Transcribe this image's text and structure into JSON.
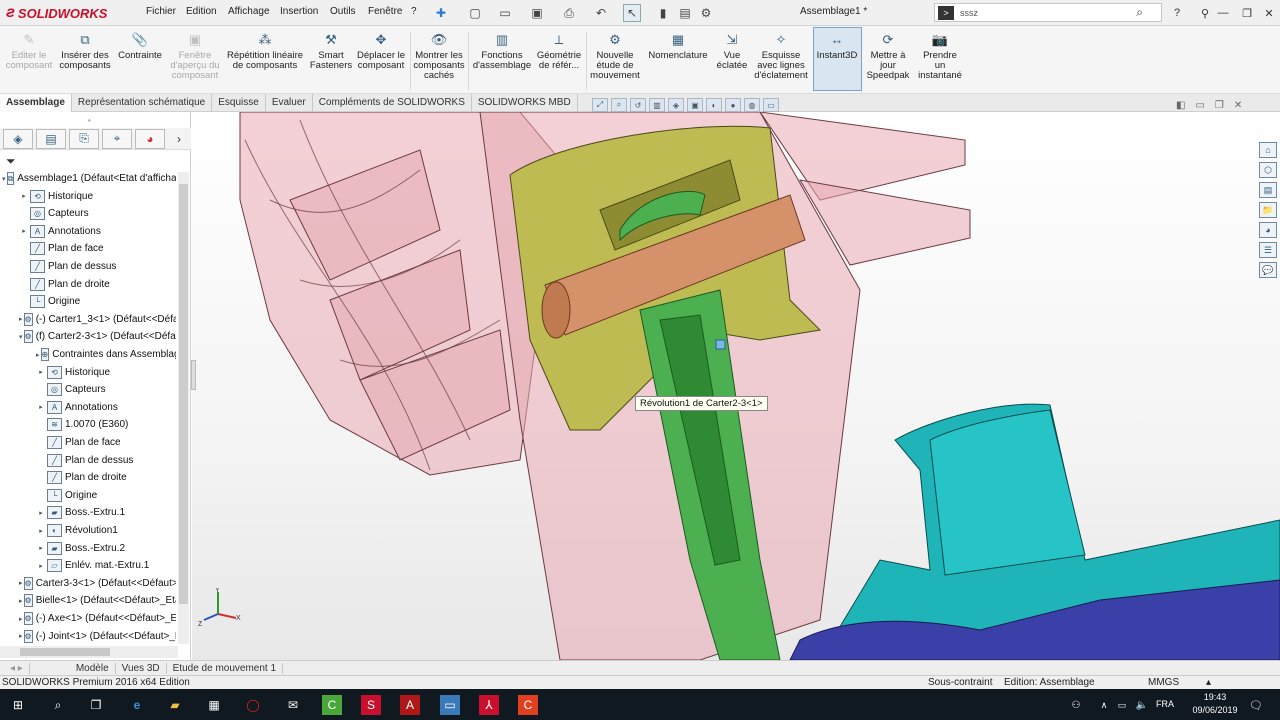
{
  "app": {
    "brand": "SOLIDWORKS",
    "doc_title": "Assemblage1 *"
  },
  "menus": [
    "Fichier",
    "Edition",
    "Affichage",
    "Insertion",
    "Outils",
    "Fenêtre",
    "?"
  ],
  "search": {
    "value": "sssz"
  },
  "ribbon": [
    {
      "label": "Editer le\ncomposant",
      "icon": "edit-component-icon",
      "disabled": true
    },
    {
      "label": "Insérer des\ncomposants",
      "icon": "insert-components-icon",
      "disabled": false
    },
    {
      "label": "Contrainte",
      "icon": "mate-icon",
      "disabled": false
    },
    {
      "label": "Fenêtre\nd'aperçu du\ncomposant",
      "icon": "component-preview-icon",
      "disabled": true
    },
    {
      "label": "Répétition linéaire\nde composants",
      "icon": "linear-pattern-icon",
      "disabled": false
    },
    {
      "label": "Smart\nFasteners",
      "icon": "smart-fasteners-icon",
      "disabled": false
    },
    {
      "label": "Déplacer le\ncomposant",
      "icon": "move-component-icon",
      "disabled": false
    },
    {
      "label": "Montrer les\ncomposants\ncachés",
      "icon": "show-hidden-icon",
      "disabled": false
    },
    {
      "label": "Fonctions\nd'assemblage",
      "icon": "assembly-features-icon",
      "disabled": false
    },
    {
      "label": "Géométrie\nde référ...",
      "icon": "reference-geometry-icon",
      "disabled": false
    },
    {
      "label": "Nouvelle\nétude de\nmouvement",
      "icon": "motion-study-icon",
      "disabled": false
    },
    {
      "label": "Nomenclature",
      "icon": "bom-icon",
      "disabled": false
    },
    {
      "label": "Vue\néclatée",
      "icon": "exploded-view-icon",
      "disabled": false
    },
    {
      "label": "Esquisse\navec lignes\nd'éclatement",
      "icon": "explode-line-sketch-icon",
      "disabled": false
    },
    {
      "label": "Instant3D",
      "icon": "instant3d-icon",
      "disabled": false,
      "active": true
    },
    {
      "label": "Mettre à\njour\nSpeedpak",
      "icon": "speedpak-icon",
      "disabled": false
    },
    {
      "label": "Prendre\nun\ninstantané",
      "icon": "snapshot-icon",
      "disabled": false
    }
  ],
  "tabs": [
    "Assemblage",
    "Représentation schématique",
    "Esquisse",
    "Evaluer",
    "Compléments de SOLIDWORKS",
    "SOLIDWORKS MBD"
  ],
  "active_tab": "Assemblage",
  "tree": [
    {
      "level": 0,
      "exp": "▾",
      "label": "Assemblage1  (Défaut<Etat d'affichag",
      "icon": "assembly-icon"
    },
    {
      "level": 1,
      "exp": "▸",
      "label": "Historique",
      "icon": "history-icon"
    },
    {
      "level": 1,
      "exp": "",
      "label": "Capteurs",
      "icon": "sensor-icon"
    },
    {
      "level": 1,
      "exp": "▸",
      "label": "Annotations",
      "icon": "annotation-icon"
    },
    {
      "level": 1,
      "exp": "",
      "label": "Plan de face",
      "icon": "plane-icon"
    },
    {
      "level": 1,
      "exp": "",
      "label": "Plan de dessus",
      "icon": "plane-icon"
    },
    {
      "level": 1,
      "exp": "",
      "label": "Plan de droite",
      "icon": "plane-icon"
    },
    {
      "level": 1,
      "exp": "",
      "label": "Origine",
      "icon": "origin-icon"
    },
    {
      "level": 1,
      "exp": "▸",
      "label": "(-) Carter1_3<1> (Défaut<<Défau",
      "icon": "part-icon"
    },
    {
      "level": 1,
      "exp": "▾",
      "label": "(f) Carter2-3<1> (Défaut<<Défau",
      "icon": "part-icon"
    },
    {
      "level": 2,
      "exp": "▸",
      "label": "Contraintes dans Assemblag",
      "icon": "mates-icon"
    },
    {
      "level": 2,
      "exp": "▸",
      "label": "Historique",
      "icon": "history-icon"
    },
    {
      "level": 2,
      "exp": "",
      "label": "Capteurs",
      "icon": "sensor-icon"
    },
    {
      "level": 2,
      "exp": "▸",
      "label": "Annotations",
      "icon": "annotation-icon"
    },
    {
      "level": 2,
      "exp": "",
      "label": "1.0070 (E360)",
      "icon": "material-icon"
    },
    {
      "level": 2,
      "exp": "",
      "label": "Plan de face",
      "icon": "plane-icon"
    },
    {
      "level": 2,
      "exp": "",
      "label": "Plan de dessus",
      "icon": "plane-icon"
    },
    {
      "level": 2,
      "exp": "",
      "label": "Plan de droite",
      "icon": "plane-icon"
    },
    {
      "level": 2,
      "exp": "",
      "label": "Origine",
      "icon": "origin-icon"
    },
    {
      "level": 2,
      "exp": "▸",
      "label": "Boss.-Extru.1",
      "icon": "extrude-icon"
    },
    {
      "level": 2,
      "exp": "▸",
      "label": "Révolution1",
      "icon": "revolve-icon"
    },
    {
      "level": 2,
      "exp": "▸",
      "label": "Boss.-Extru.2",
      "icon": "extrude-icon"
    },
    {
      "level": 2,
      "exp": "▸",
      "label": "Enlév. mat.-Extru.1",
      "icon": "cut-extrude-icon"
    },
    {
      "level": 1,
      "exp": "▸",
      "label": "Carter3-3<1> (Défaut<<Défaut>_",
      "icon": "part-icon"
    },
    {
      "level": 1,
      "exp": "▸",
      "label": "Bielle<1> (Défaut<<Défaut>_Eta",
      "icon": "part-icon"
    },
    {
      "level": 1,
      "exp": "▸",
      "label": "(-) Axe<1> (Défaut<<Défaut>_Et",
      "icon": "part-icon"
    },
    {
      "level": 1,
      "exp": "▸",
      "label": "(-) Joint<1> (Défaut<<Défaut>_E",
      "icon": "part-icon"
    }
  ],
  "tooltip": "Révolution1 de Carter2-3<1>",
  "bottom_tabs": [
    "Modèle",
    "Vues 3D",
    "Etude de mouvement 1"
  ],
  "active_bottom_tab": "Modèle",
  "status": {
    "edition": "SOLIDWORKS Premium 2016 x64 Edition",
    "constraint": "Sous-contraint",
    "mode": "Edition: Assemblage",
    "units": "MMGS"
  },
  "taskbar": {
    "lang": "FRA",
    "time": "19:43",
    "date": "09/06/2019"
  },
  "triad": {
    "x": "X",
    "y": "Y",
    "z": "Z"
  },
  "colors": {
    "brand": "#c8102e",
    "piston": "#c6c35a",
    "pin": "#d08b5a",
    "rod": "#4caf50",
    "housing": "#e7a9b0",
    "teal": "#1fb5b8",
    "purple": "#3b3fa8"
  }
}
